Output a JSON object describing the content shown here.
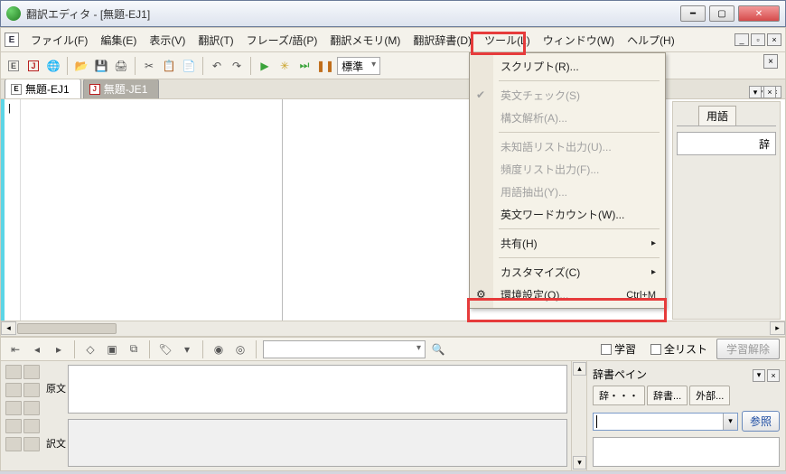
{
  "title": "翻訳エディタ - [無題-EJ1]",
  "menubar": {
    "file": "ファイル(F)",
    "edit": "編集(E)",
    "view": "表示(V)",
    "trans": "翻訳(T)",
    "phrase": "フレーズ/語(P)",
    "tm": "翻訳メモリ(M)",
    "dict": "翻訳辞書(D)",
    "tools": "ツール(L)",
    "window": "ウィンドウ(W)",
    "help": "ヘルプ(H)"
  },
  "toolbar": {
    "trans_mode": "標準"
  },
  "doctabs": {
    "tab1": "無題-EJ1",
    "tab2": "無題-JE1"
  },
  "tools_menu": {
    "script": "スクリプト(R)...",
    "eng_check": "英文チェック(S)",
    "parse": "構文解析(A)...",
    "unknown_words": "未知語リスト出力(U)...",
    "freq_list": "頻度リスト出力(F)...",
    "term_extract": "用語抽出(Y)...",
    "word_count": "英文ワードカウント(W)...",
    "share": "共有(H)",
    "customize": "カスタマイズ(C)",
    "preferences": "環境設定(O)...",
    "preferences_shortcut": "Ctrl+M"
  },
  "right_panel": {
    "tab_terms": "用語",
    "dict_label": "辞"
  },
  "lower_bar": {
    "learn_chk": "学習",
    "all_list_chk": "全リスト",
    "unlearn_btn": "学習解除"
  },
  "bottom_left": {
    "label_src": "原文",
    "label_tgt": "訳文"
  },
  "dict_pane": {
    "title": "辞書ペイン",
    "tab1": "辞・・・",
    "tab2": "辞書...",
    "tab3": "外部...",
    "ref_btn": "参照"
  }
}
